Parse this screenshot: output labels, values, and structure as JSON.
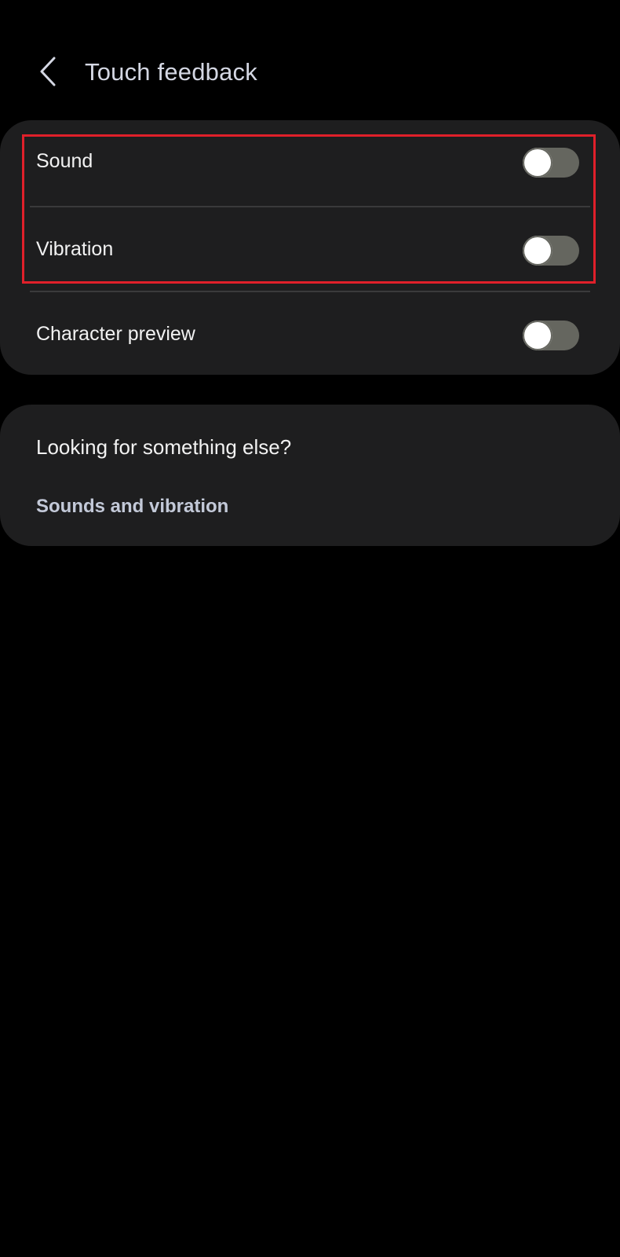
{
  "header": {
    "title": "Touch feedback",
    "back_icon": "chevron-left-icon"
  },
  "settings": {
    "items": [
      {
        "label": "Sound",
        "enabled": false
      },
      {
        "label": "Vibration",
        "enabled": false
      },
      {
        "label": "Character preview",
        "enabled": false
      }
    ]
  },
  "suggestions": {
    "title": "Looking for something else?",
    "link": "Sounds and vibration"
  },
  "colors": {
    "background": "#000000",
    "card": "#1e1e1f",
    "toggle_off_track": "#65665f",
    "highlight": "#e0202a",
    "link": "#c3c9d8"
  }
}
